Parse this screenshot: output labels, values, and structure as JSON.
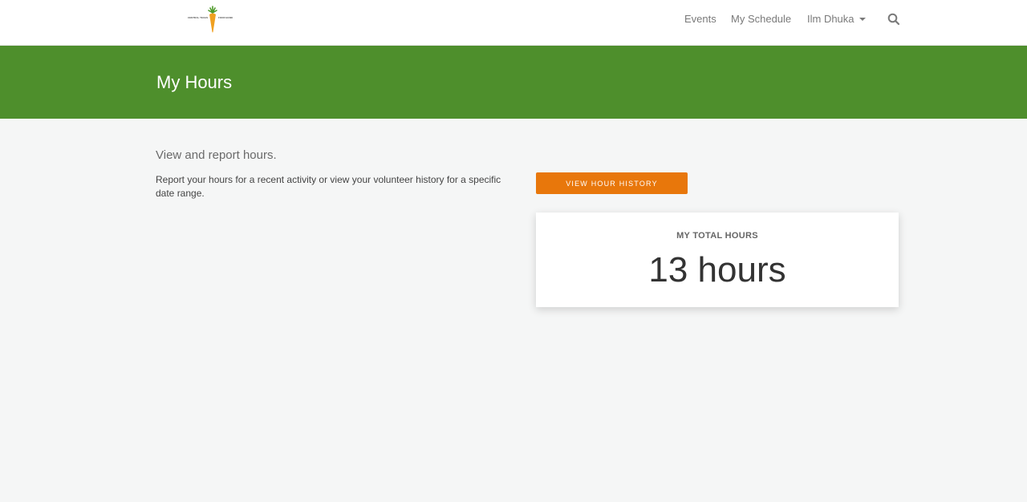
{
  "header": {
    "logo": {
      "text_left": "CENTRAL TEXAS",
      "text_right": "FOOD BANK",
      "icon": "carrot-icon"
    },
    "nav": {
      "events": "Events",
      "my_schedule": "My Schedule",
      "user": "Ilm Dhuka",
      "search_icon": "search-icon"
    }
  },
  "banner": {
    "title": "My Hours",
    "color": "#4e8f2c"
  },
  "main": {
    "subheading": "View and report hours.",
    "description": "Report your hours for a recent activity or view your volunteer history for a specific date range.",
    "history_button": "VIEW HOUR HISTORY",
    "history_button_color": "#e8770b",
    "total_card": {
      "label": "MY TOTAL HOURS",
      "value": "13 hours"
    }
  }
}
